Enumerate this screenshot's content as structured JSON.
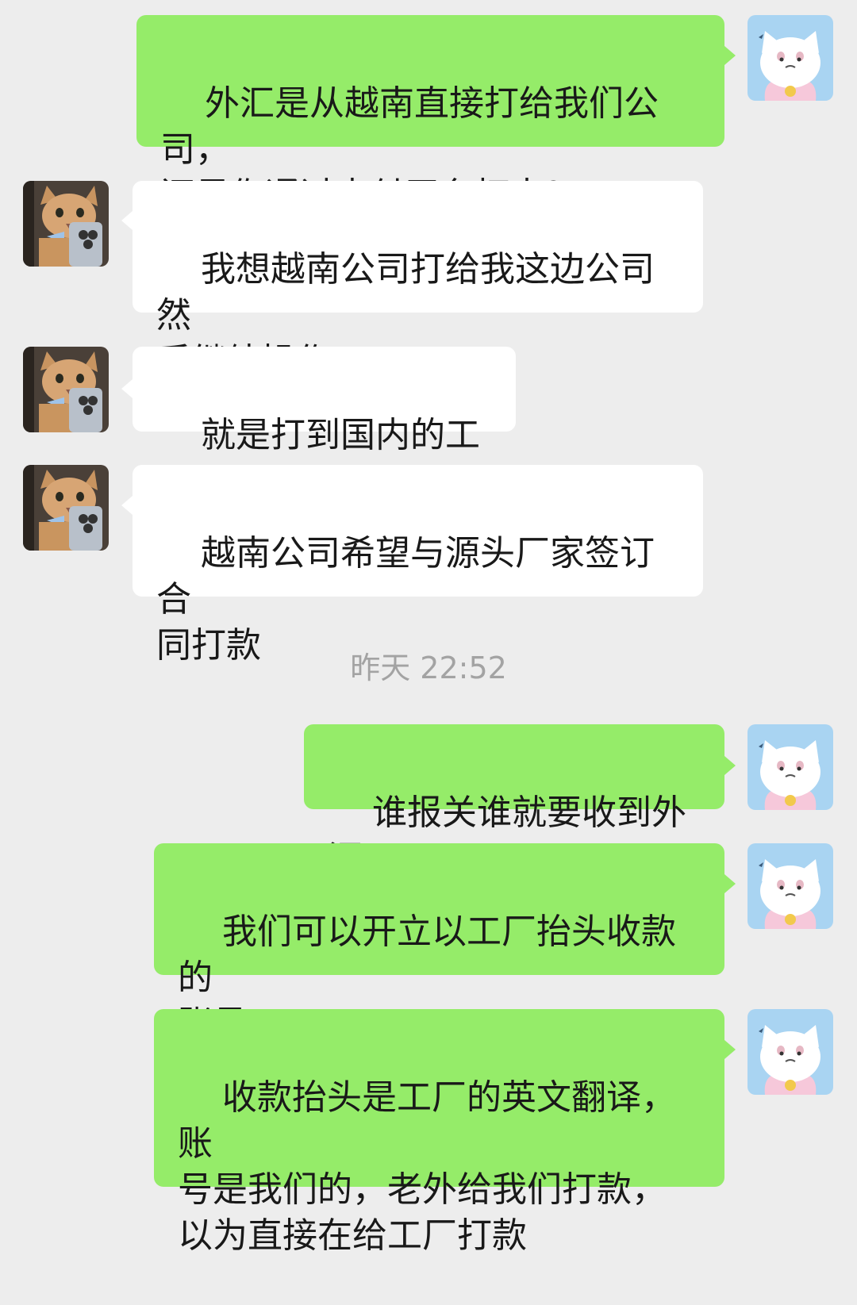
{
  "chat": {
    "messages": [
      {
        "sender": "me",
        "text": "外汇是从越南直接打给我们公司，\n还是你通过支付平台打来？"
      },
      {
        "sender": "other",
        "text": "我想越南公司打给我这边公司然\n后继续操作"
      },
      {
        "sender": "other",
        "text": "就是打到国内的工厂"
      },
      {
        "sender": "other",
        "text": "越南公司希望与源头厂家签订合\n同打款"
      },
      {
        "sender": "me",
        "text": "谁报关谁就要收到外汇"
      },
      {
        "sender": "me",
        "text": "我们可以开立以工厂抬头收款的\n账号"
      },
      {
        "sender": "me",
        "text": "收款抬头是工厂的英文翻译，账\n号是我们的，老外给我们打款，\n以为直接在给工厂打款"
      }
    ],
    "timestamp": "昨天 22:52"
  },
  "colors": {
    "background": "#ededed",
    "outgoing_bubble": "#95ec69",
    "incoming_bubble": "#ffffff",
    "timestamp_text": "#a3a3a3"
  },
  "avatars": {
    "me": "cartoon-cat-avatar-icon",
    "other": "cat-photo-avatar-icon"
  }
}
